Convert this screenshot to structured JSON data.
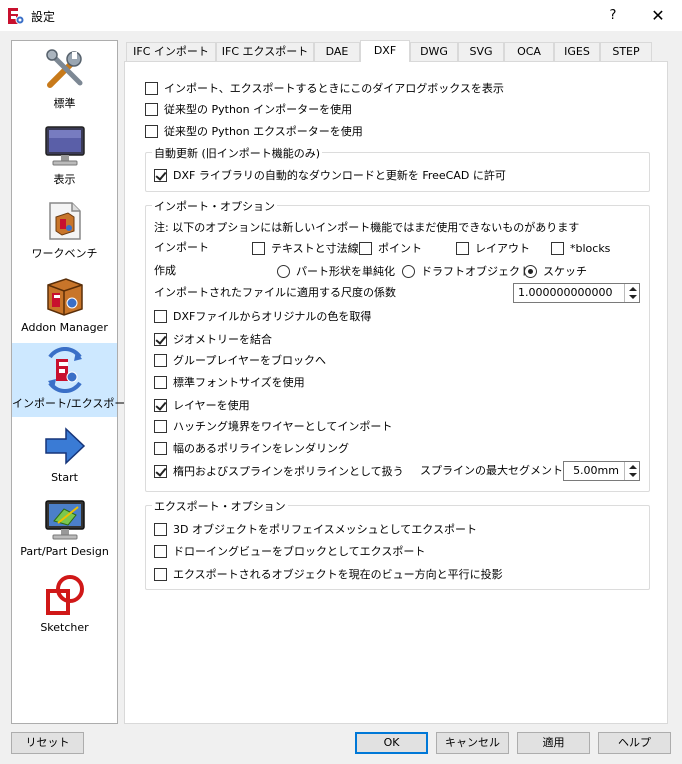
{
  "window": {
    "title": "設定",
    "help_label": "?",
    "close_label": "✕"
  },
  "sidebar": {
    "items": [
      {
        "label": "標準",
        "icon": "tools-icon"
      },
      {
        "label": "表示",
        "icon": "monitor-icon"
      },
      {
        "label": "ワークベンチ",
        "icon": "workbench-icon"
      },
      {
        "label": "Addon Manager",
        "icon": "addon-box-icon"
      },
      {
        "label": "インポート/エクスポート",
        "icon": "import-export-icon",
        "selected": true
      },
      {
        "label": "Start",
        "icon": "arrow-right-icon"
      },
      {
        "label": "Part/Part Design",
        "icon": "part-design-icon"
      },
      {
        "label": "Sketcher",
        "icon": "sketcher-icon"
      }
    ]
  },
  "tabs": [
    {
      "label": "IFC インポート"
    },
    {
      "label": "IFC エクスポート"
    },
    {
      "label": "DAE"
    },
    {
      "label": "DXF",
      "active": true
    },
    {
      "label": "DWG"
    },
    {
      "label": "SVG"
    },
    {
      "label": "OCA"
    },
    {
      "label": "IGES"
    },
    {
      "label": "STEP"
    }
  ],
  "dxf": {
    "top_options": [
      {
        "label": "インポート、エクスポートするときにこのダイアログボックスを表示",
        "checked": false
      },
      {
        "label": "従来型の Python インポーターを使用",
        "checked": false
      },
      {
        "label": "従来型の Python エクスポーターを使用",
        "checked": false
      }
    ],
    "auto_update": {
      "title": "自動更新 (旧インポート機能のみ)",
      "option": {
        "label": "DXF ライブラリの自動的なダウンロードと更新を FreeCAD に許可",
        "checked": true
      }
    },
    "import_options": {
      "title": "インポート・オプション",
      "note": "注: 以下のオプションには新しいインポート機能ではまだ使用できないものがあります",
      "import_label": "インポート",
      "import_checks": [
        {
          "label": "テキストと寸法線",
          "checked": false
        },
        {
          "label": "ポイント",
          "checked": false
        },
        {
          "label": "レイアウト",
          "checked": false
        },
        {
          "label": "*blocks",
          "checked": false
        }
      ],
      "create_label": "作成",
      "create_radios": [
        {
          "label": "パート形状を単純化",
          "checked": false
        },
        {
          "label": "ドラフトオブジェクト",
          "checked": false
        },
        {
          "label": "スケッチ",
          "checked": true
        }
      ],
      "scale_label": "インポートされたファイルに適用する尺度の係数",
      "scale_value": "1.000000000000",
      "options": [
        {
          "label": "DXFファイルからオリジナルの色を取得",
          "checked": false
        },
        {
          "label": "ジオメトリーを結合",
          "checked": true
        },
        {
          "label": "グループレイヤーをブロックへ",
          "checked": false
        },
        {
          "label": "標準フォントサイズを使用",
          "checked": false
        },
        {
          "label": "レイヤーを使用",
          "checked": true
        },
        {
          "label": "ハッチング境界をワイヤーとしてインポート",
          "checked": false
        },
        {
          "label": "幅のあるポリラインをレンダリング",
          "checked": false
        },
        {
          "label": "楕円およびスプラインをポリラインとして扱う",
          "checked": true
        }
      ],
      "spline_label": "スプラインの最大セグメント数:",
      "spline_value": "5.00mm"
    },
    "export_options": {
      "title": "エクスポート・オプション",
      "options": [
        {
          "label": "3D オブジェクトをポリフェイスメッシュとしてエクスポート",
          "checked": false
        },
        {
          "label": "ドローイングビューをブロックとしてエクスポート",
          "checked": false
        },
        {
          "label": "エクスポートされるオブジェクトを現在のビュー方向と平行に投影",
          "checked": false
        }
      ]
    }
  },
  "buttons": {
    "reset": "リセット",
    "ok": "OK",
    "cancel": "キャンセル",
    "apply": "適用",
    "help": "ヘルプ"
  }
}
